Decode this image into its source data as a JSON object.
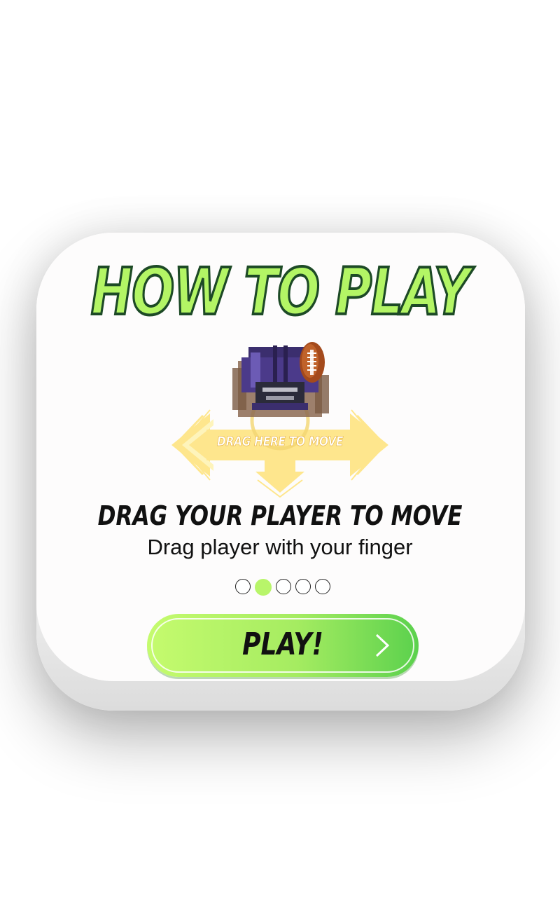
{
  "dialog": {
    "title": "HOW TO PLAY",
    "illustration_hint": "DRAG HERE TO MOVE",
    "heading": "DRAG YOUR PLAYER TO MOVE",
    "description": "Drag player with your finger",
    "page_indicator": {
      "total_pages": 5,
      "current_page": 2
    },
    "play_button_label": "PLAY!"
  },
  "icons": {
    "player": "football-player-helmet-icon",
    "ball": "football-icon",
    "arrows": "drag-arrows-icon",
    "play_chevron": "chevron-right-icon"
  },
  "colors": {
    "title_fill": "#b3f565",
    "title_outline": "#1d4a26",
    "button_start": "#c5fb6e",
    "button_end": "#5bd14d",
    "active_dot": "#b8f56a",
    "arrow_yellow": "#ffe37a",
    "helmet_purple": "#4b3a8a"
  }
}
